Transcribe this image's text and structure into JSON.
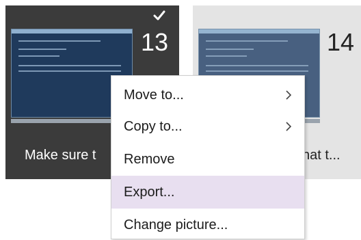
{
  "slides": [
    {
      "number": "13",
      "caption": "Make sure t",
      "selected": true,
      "check_icon": "check-icon"
    },
    {
      "number": "14",
      "caption": "hat t...",
      "selected": false
    }
  ],
  "context_menu": {
    "items": [
      {
        "label": "Move to...",
        "has_submenu": true
      },
      {
        "label": "Copy to...",
        "has_submenu": true
      },
      {
        "label": "Remove",
        "has_submenu": false
      },
      {
        "label": "Export...",
        "has_submenu": false,
        "highlighted": true
      },
      {
        "label": "Change picture...",
        "has_submenu": false
      }
    ]
  },
  "colors": {
    "selected_tile_bg": "#3b3b3b",
    "unselected_tile_bg": "#e4e4e4",
    "menu_highlight": "#e8dff0"
  }
}
